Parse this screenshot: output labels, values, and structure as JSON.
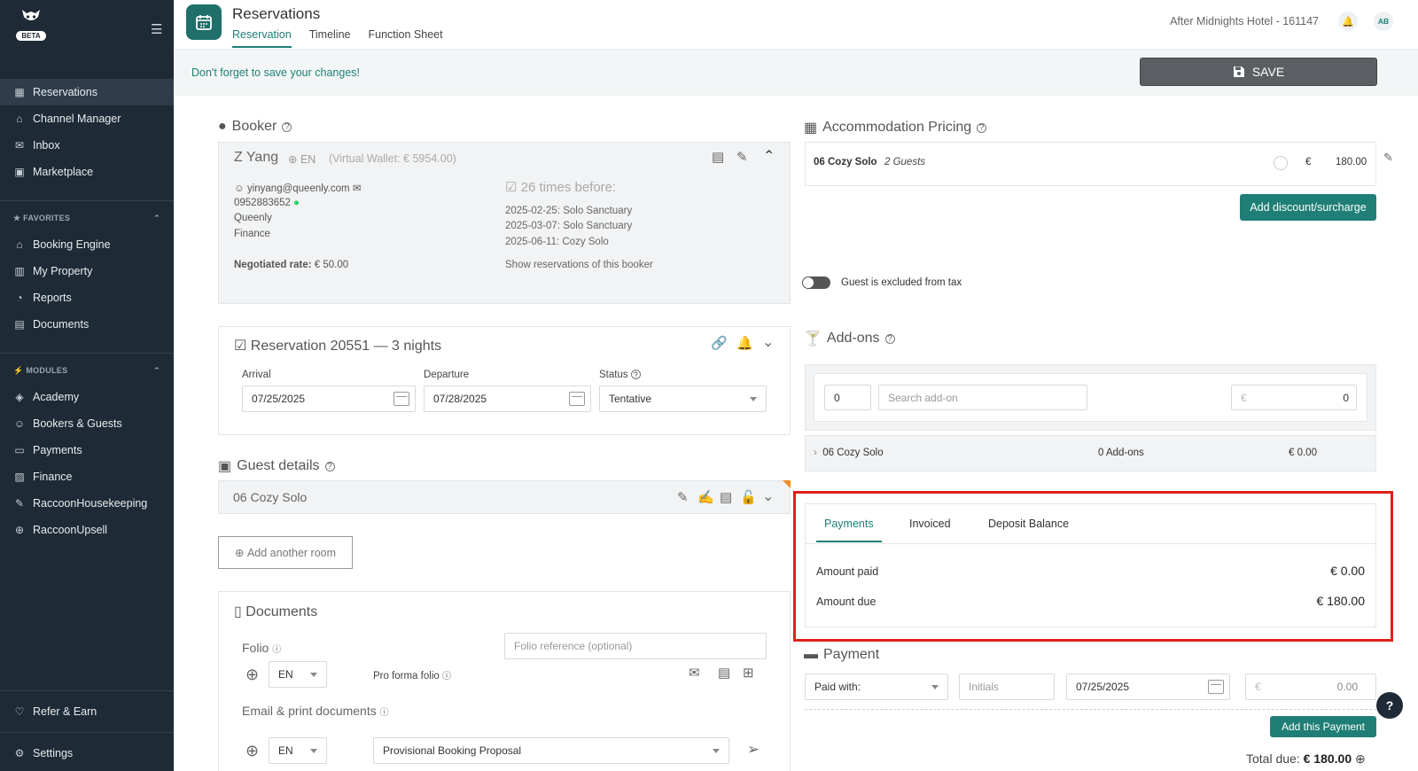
{
  "sidebar": {
    "logo_icon": "raccoon-logo",
    "beta": "BETA",
    "main_items": [
      {
        "label": "Reservations",
        "icon": "calendar-icon",
        "glyph": "▦"
      },
      {
        "label": "Channel Manager",
        "icon": "channel-icon",
        "glyph": "⌂"
      },
      {
        "label": "Inbox",
        "icon": "inbox-icon",
        "glyph": "✉"
      },
      {
        "label": "Marketplace",
        "icon": "marketplace-icon",
        "glyph": "▣"
      }
    ],
    "favorites_label": "FAVORITES",
    "favorites": [
      {
        "label": "Booking Engine",
        "icon": "booking-engine-icon",
        "glyph": "⌂"
      },
      {
        "label": "My Property",
        "icon": "property-icon",
        "glyph": "▥"
      },
      {
        "label": "Reports",
        "icon": "reports-icon",
        "glyph": "◔"
      },
      {
        "label": "Documents",
        "icon": "documents-icon",
        "glyph": "▤"
      }
    ],
    "modules_label": "MODULES",
    "modules": [
      {
        "label": "Academy",
        "icon": "academy-icon",
        "glyph": "◈"
      },
      {
        "label": "Bookers & Guests",
        "icon": "bookers-icon",
        "glyph": "☺"
      },
      {
        "label": "Payments",
        "icon": "payments-icon",
        "glyph": "▭"
      },
      {
        "label": "Finance",
        "icon": "finance-icon",
        "glyph": "▨"
      },
      {
        "label": "RaccoonHousekeeping",
        "icon": "housekeeping-icon",
        "glyph": "✎"
      },
      {
        "label": "RaccoonUpsell",
        "icon": "upsell-icon",
        "glyph": "⊕"
      }
    ],
    "refer": {
      "label": "Refer & Earn",
      "icon": "heart-icon",
      "glyph": "♡"
    },
    "settings": {
      "label": "Settings",
      "icon": "gear-icon",
      "glyph": "⚙"
    }
  },
  "header": {
    "title": "Reservations",
    "tabs": [
      "Reservation",
      "Timeline",
      "Function Sheet"
    ],
    "hotel": "After Midnights Hotel - 161147",
    "avatar": "AB"
  },
  "savebar": {
    "message": "Don't forget to save your changes!",
    "save_label": "SAVE"
  },
  "booker": {
    "title": "Booker",
    "name": "Z Yang",
    "lang": "EN",
    "wallet": "(Virtual Wallet: € 5954.00)",
    "email": "yinyang@queenly.com",
    "phone": "0952883652",
    "company": "Queenly",
    "department": "Finance",
    "negotiated_label": "Negotiated rate:",
    "negotiated_value": "€ 50.00",
    "times_before": "26 times before:",
    "history": [
      "2025-02-25: Solo Sanctuary",
      "2025-03-07: Solo Sanctuary",
      "2025-06-11: Cozy Solo"
    ],
    "show_link": "Show reservations of this booker"
  },
  "reservation": {
    "title": "Reservation 20551",
    "dash": "—",
    "nights": "3 nights",
    "arrival_label": "Arrival",
    "arrival": "07/25/2025",
    "departure_label": "Departure",
    "departure": "07/28/2025",
    "status_label": "Status",
    "status": "Tentative"
  },
  "guest": {
    "title": "Guest details",
    "room": "06 Cozy Solo",
    "add_room": "Add another room"
  },
  "documents": {
    "title": "Documents",
    "folio_label": "Folio",
    "folio_placeholder": "Folio reference (optional)",
    "lang": "EN",
    "proforma": "Pro forma folio",
    "email_label": "Email & print documents",
    "email_lang": "EN",
    "template": "Provisional Booking Proposal"
  },
  "pricing": {
    "title": "Accommodation Pricing",
    "room": "06 Cozy Solo",
    "guests": "2 Guests",
    "currency": "€",
    "amount": "180.00",
    "discount_btn": "Add discount/surcharge",
    "tax_label": "Guest is excluded from tax"
  },
  "addons": {
    "title": "Add-ons",
    "qty": "0",
    "search_placeholder": "Search add-on",
    "currency": "€",
    "price": "0",
    "row_room": "06 Cozy Solo",
    "row_count": "0 Add-ons",
    "row_total": "€ 0.00"
  },
  "payments_panel": {
    "tabs": [
      "Payments",
      "Invoiced",
      "Deposit Balance"
    ],
    "paid_label": "Amount paid",
    "paid_value": "€ 0.00",
    "due_label": "Amount due",
    "due_value": "€ 180.00"
  },
  "payment": {
    "title": "Payment",
    "paid_with": "Paid with:",
    "initials_placeholder": "Initials",
    "date": "07/25/2025",
    "currency": "€",
    "amount": "0.00",
    "add_btn": "Add this Payment",
    "total_label": "Total due:",
    "total_value": "€ 180.00"
  },
  "colors": {
    "accent": "#1f7f76",
    "sidebar": "#1e2a35",
    "highlight": "#e0201a"
  }
}
